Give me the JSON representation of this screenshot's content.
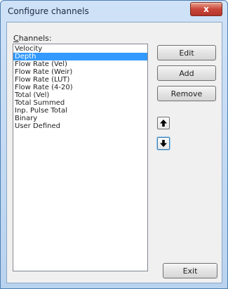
{
  "window": {
    "title": "Configure channels",
    "close_glyph": "x"
  },
  "channels": {
    "label_mnemonic": "C",
    "label_rest": "hannels:",
    "items": [
      "Velocity",
      "Depth",
      "Flow Rate (Vel)",
      "Flow Rate (Weir)",
      "Flow Rate (LUT)",
      "Flow Rate (4-20)",
      "Total (Vel)",
      "Total Summed",
      "Inp. Pulse Total",
      "Binary",
      "User Defined"
    ],
    "selected": "Depth"
  },
  "buttons": {
    "edit": "Edit",
    "add": "Add",
    "remove": "Remove",
    "exit": "Exit"
  },
  "icons": {
    "move_up": "arrow-up-icon",
    "move_down": "arrow-down-icon"
  },
  "colors": {
    "selection": "#3399ff",
    "close_button": "#c9463a"
  }
}
